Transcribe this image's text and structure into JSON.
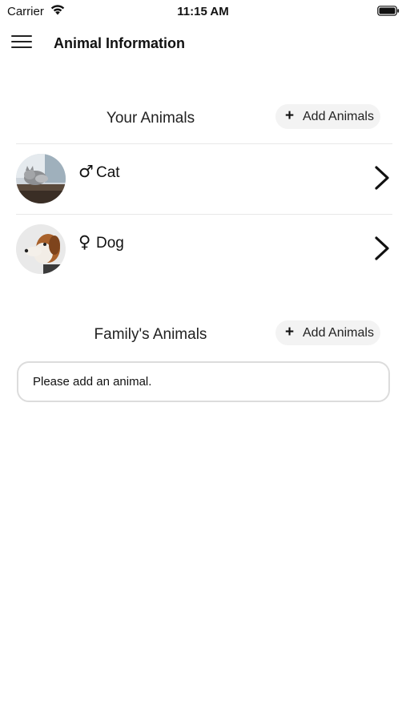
{
  "status_bar": {
    "carrier": "Carrier",
    "time": "11:15 AM",
    "wifi_icon": "wifi-icon",
    "battery_icon": "battery-icon"
  },
  "nav": {
    "menu_icon": "hamburger-menu-icon",
    "title": "Animal Information"
  },
  "your_animals": {
    "title": "Your Animals",
    "add_button": {
      "icon": "plus-icon",
      "label": "Add Animals"
    },
    "items": [
      {
        "gender_symbol": "♂",
        "gender": "male",
        "name": "Cat",
        "avatar": "cat-photo",
        "chevron": "chevron-right-icon"
      },
      {
        "gender_symbol": "♀",
        "gender": "female",
        "name": "Dog",
        "avatar": "dog-photo",
        "chevron": "chevron-right-icon"
      }
    ]
  },
  "family_animals": {
    "title": "Family's Animals",
    "add_button": {
      "icon": "plus-icon",
      "label": "Add Animals"
    },
    "empty_message": "Please add an animal."
  }
}
